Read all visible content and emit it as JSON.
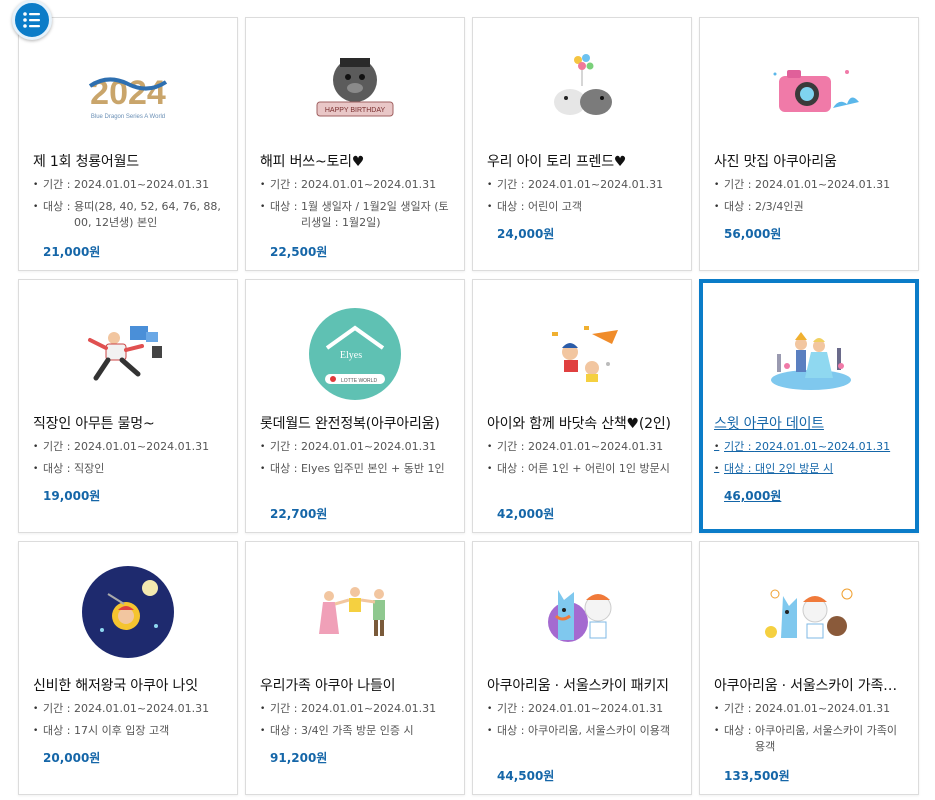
{
  "cards": [
    {
      "title": "제 1회 청룡어월드",
      "period_label": "기간 : ",
      "period": "2024.01.01~2024.01.31",
      "target_label": "대상 : ",
      "target": "용띠(28, 40, 52, 64, 76, 88, 00, 12년생) 본인",
      "price": "21,000원",
      "image": "2024-dragon-logo"
    },
    {
      "title": "해피 버쓰~토리♥",
      "period_label": "기간 : ",
      "period": "2024.01.01~2024.01.31",
      "target_label": "대상 : ",
      "target": "1월 생일자 / 1월2일 생일자 (토리생일 : 1월2일)",
      "price": "22,500원",
      "image": "seal-birthday"
    },
    {
      "title": "우리 아이 토리 프렌드♥",
      "period_label": "기간 : ",
      "period": "2024.01.01~2024.01.31",
      "target_label": "대상 : ",
      "target": "어린이 고객",
      "price": "24,000원",
      "image": "seal-friends-balloons"
    },
    {
      "title": "사진 맛집 아쿠아리움",
      "period_label": "기간 : ",
      "period": "2024.01.01~2024.01.31",
      "target_label": "대상 : ",
      "target": "2/3/4인권",
      "price": "56,000원",
      "image": "pink-camera"
    },
    {
      "title": "직장인 아무튼 물멍~",
      "period_label": "기간 : ",
      "period": "2024.01.01~2024.01.31",
      "target_label": "대상 : ",
      "target": "직장인",
      "price": "19,000원",
      "image": "office-worker-running"
    },
    {
      "title": "롯데월드 완전정복(아쿠아리움)",
      "period_label": "기간 : ",
      "period": "2024.01.01~2024.01.31",
      "target_label": "대상 : ",
      "target": "Elyes 입주민 본인 + 동반 1인",
      "price": "22,700원",
      "image": "elyes-lotte-world-logo"
    },
    {
      "title": "아이와 함께 바닷속 산책♥(2인)",
      "period_label": "기간 : ",
      "period": "2024.01.01~2024.01.31",
      "target_label": "대상 : ",
      "target": "어른 1인 + 어린이 1인 방문시",
      "price": "42,000원",
      "image": "kids-flying"
    },
    {
      "title": "스윗 아쿠아 데이트",
      "period_label": "기간 : ",
      "period": "2024.01.01~2024.01.31",
      "target_label": "대상 : ",
      "target": "대인 2인 방문 시",
      "price": "46,000원",
      "image": "prince-princess"
    },
    {
      "title": "신비한 해저왕국 아쿠아 나잇",
      "period_label": "기간 : ",
      "period": "2024.01.01~2024.01.31",
      "target_label": "대상 : ",
      "target": "17시 이후 입장 고객",
      "price": "20,000원",
      "image": "submarine-night"
    },
    {
      "title": "우리가족 아쿠아 나들이",
      "period_label": "기간 : ",
      "period": "2024.01.01~2024.01.31",
      "target_label": "대상 : ",
      "target": "3/4인 가족 방문 인증 시",
      "price": "91,200원",
      "image": "family-jump"
    },
    {
      "title": "아쿠아리움 · 서울스카이 패키지",
      "period_label": "기간 : ",
      "period": "2024.01.01~2024.01.31",
      "target_label": "대상 : ",
      "target": "아쿠아리움, 서울스카이 이용객",
      "price": "44,500원",
      "image": "mascots-pair"
    },
    {
      "title": "아쿠아리움 · 서울스카이 가족…",
      "period_label": "기간 : ",
      "period": "2024.01.01~2024.01.31",
      "target_label": "대상 : ",
      "target": "아쿠아리움, 서울스카이 가족이용객",
      "price": "133,500원",
      "image": "mascots-family"
    }
  ],
  "image_text": {
    "year": "2024",
    "tagline": "Blue Dragon Series A World",
    "banner": "HAPPY BIRTHDAY",
    "elyes": "Elyes",
    "lotte": "LOTTE WORLD"
  },
  "colors": {
    "accent": "#0b7cc8",
    "price": "#1566a8"
  }
}
